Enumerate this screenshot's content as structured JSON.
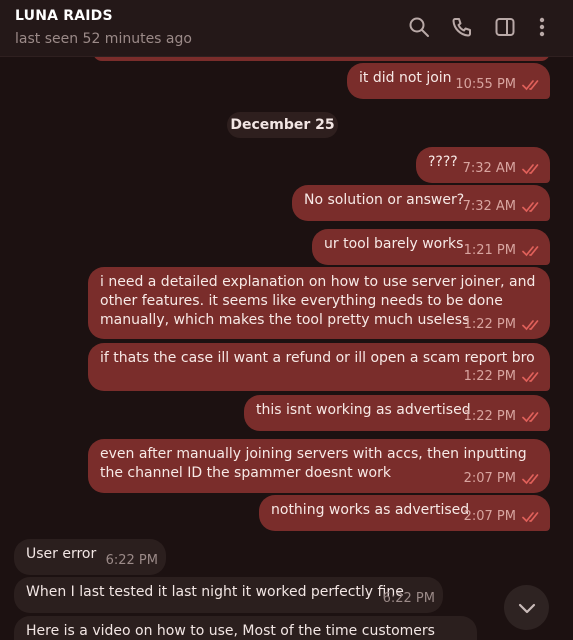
{
  "header": {
    "title": "LUNA RAIDS",
    "status": "last seen 52 minutes ago",
    "icons": [
      "search-icon",
      "phone-icon",
      "sidebar-toggle-icon",
      "more-icon"
    ]
  },
  "date_separator": "December 25",
  "messages": [
    {
      "dir": "out",
      "text": "it did not join",
      "time": "10:55 PM",
      "read": true
    },
    {
      "dir": "out",
      "text": "????",
      "time": "7:32 AM",
      "read": true
    },
    {
      "dir": "out",
      "text": "No solution or answer?",
      "time": "7:32 AM",
      "read": true
    },
    {
      "dir": "out",
      "text": "ur tool barely works",
      "time": "1:21 PM",
      "read": true
    },
    {
      "dir": "out",
      "text": "i need a detailed explanation on how to use server joiner, and other features. it seems like everything needs to be done manually, which makes the tool pretty much useless",
      "time": "1:22 PM",
      "read": true
    },
    {
      "dir": "out",
      "text": "if thats the case ill want a refund or ill open a scam report bro",
      "time": "1:22 PM",
      "read": true
    },
    {
      "dir": "out",
      "text": "this isnt working as advertised",
      "time": "1:22 PM",
      "read": true
    },
    {
      "dir": "out",
      "text": "even after manually joining servers with accs, then inputting the channel ID the spammer doesnt work",
      "time": "2:07 PM",
      "read": true
    },
    {
      "dir": "out",
      "text": "nothing works as advertised",
      "time": "2:07 PM",
      "read": true
    },
    {
      "dir": "in",
      "text": "User error",
      "time": "6:22 PM"
    },
    {
      "dir": "in",
      "text": "When I last tested it last night it worked perfectly fine",
      "time": "6:22 PM"
    },
    {
      "dir": "in",
      "text": "Here is a video on how to use, Most of the time customers Input",
      "time": ""
    }
  ],
  "colors": {
    "background": "#1c1111",
    "outgoing_bubble": "#7a2d2b",
    "incoming_bubble": "#2b1f1e",
    "read_check": "#e0605a"
  }
}
